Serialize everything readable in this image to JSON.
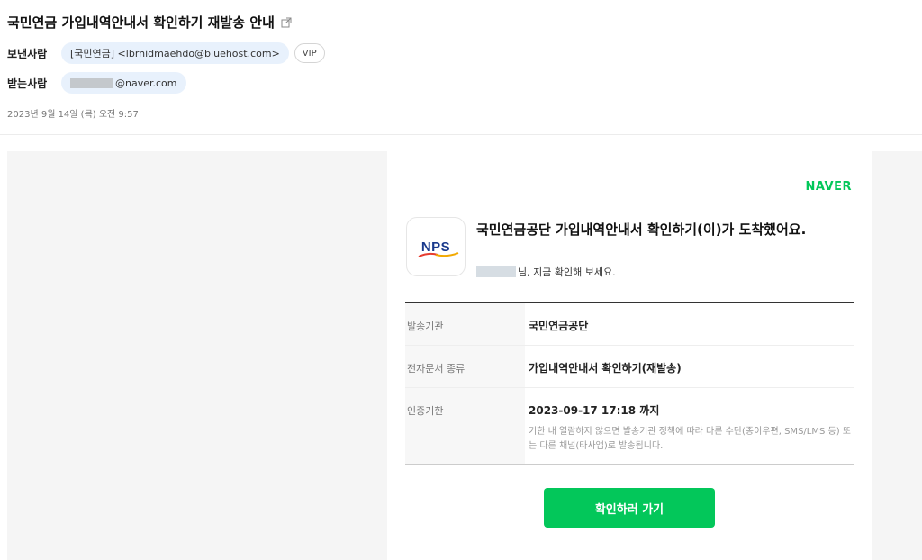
{
  "email": {
    "subject": "국민연금 가입내역안내서 확인하기 재발송 안내",
    "sender_label": "보낸사람",
    "sender": "[국민연금] <lbrnidmaehdo@bluehost.com>",
    "vip_label": "VIP",
    "recipient_label": "받는사람",
    "recipient_domain": "@naver.com",
    "date": "2023년 9월 14일 (목) 오전 9:57"
  },
  "card": {
    "brand": "NAVER",
    "logo_text": "NPS",
    "title": "국민연금공단 가입내역안내서 확인하기(이)가 도착했어요.",
    "greeting": "님, 지금 확인해 보세요.",
    "rows": [
      {
        "label": "발송기관",
        "value": "국민연금공단"
      },
      {
        "label": "전자문서 종류",
        "value": "가입내역안내서 확인하기(재발송)"
      },
      {
        "label": "인증기한",
        "value": "2023-09-17 17:18 까지",
        "note": "기한 내 열람하지 않으면 발송기관 정책에 따라 다른 수단(종이우편, SMS/LMS 등) 또는 다른 채널(타사앱)로 발송됩니다."
      }
    ],
    "button_label": "확인하러 가기"
  },
  "colors": {
    "accent": "#03c75a",
    "chip_bg": "#e8f1fc",
    "logo_blue": "#1a3a8c"
  },
  "icons": {
    "subject": "external-link-icon"
  }
}
